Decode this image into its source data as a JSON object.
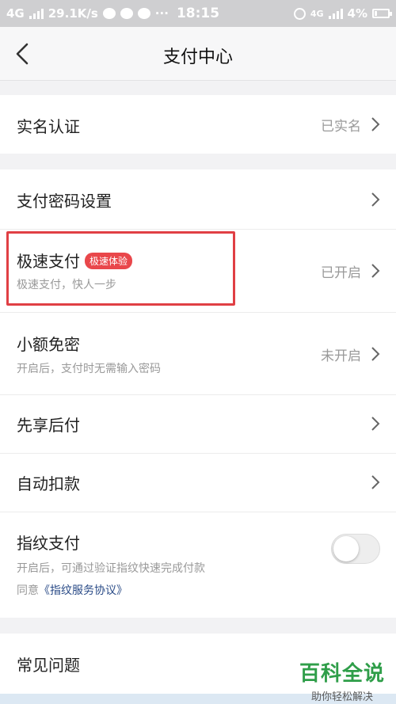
{
  "status_bar": {
    "network": "4G",
    "speed": "29.1K/s",
    "dots": "···",
    "time": "18:15",
    "network_right": "4G",
    "battery": "4%"
  },
  "nav": {
    "title": "支付中心"
  },
  "sections": {
    "realname": {
      "label": "实名认证",
      "value": "已实名"
    },
    "password": {
      "label": "支付密码设置"
    },
    "fastpay": {
      "label": "极速支付",
      "badge": "极速体验",
      "sub": "极速支付，快人一步",
      "value": "已开启"
    },
    "smallfree": {
      "label": "小额免密",
      "sub": "开启后，支付时无需输入密码",
      "value": "未开启"
    },
    "paylater": {
      "label": "先享后付"
    },
    "autodeduct": {
      "label": "自动扣款"
    },
    "fingerprint": {
      "label": "指纹支付",
      "sub": "开启后，可通过验证指纹快速完成付款",
      "agree_prefix": "同意",
      "agree_link": "《指纹服务协议》",
      "enabled": false
    },
    "faq": {
      "label": "常见问题"
    }
  },
  "watermark": {
    "line1": "百科全说",
    "line2": "助你轻松解决"
  },
  "colors": {
    "badge": "#e9474b",
    "highlight": "#e03f44",
    "link": "#2a4b87",
    "watermark": "#2f9e49"
  }
}
